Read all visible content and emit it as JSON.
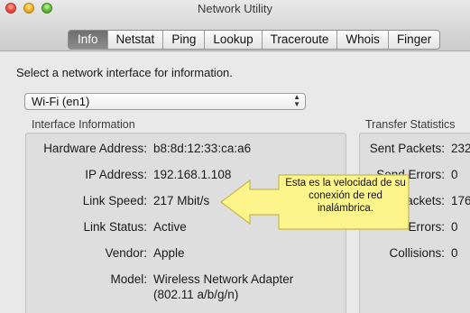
{
  "window": {
    "title": "Network Utility"
  },
  "tabs": [
    {
      "label": "Info",
      "active": true
    },
    {
      "label": "Netstat"
    },
    {
      "label": "Ping"
    },
    {
      "label": "Lookup"
    },
    {
      "label": "Traceroute"
    },
    {
      "label": "Whois"
    },
    {
      "label": "Finger"
    }
  ],
  "prompt": "Select a network interface for information.",
  "interface_select": {
    "value": "Wi-Fi (en1)"
  },
  "interface_info": {
    "label": "Interface Information",
    "rows": [
      {
        "label": "Hardware Address:",
        "value": "b8:8d:12:33:ca:a6"
      },
      {
        "label": "IP Address:",
        "value": "192.168.1.108"
      },
      {
        "label": "Link Speed:",
        "value": "217 Mbit/s"
      },
      {
        "label": "Link Status:",
        "value": "Active"
      },
      {
        "label": "Vendor:",
        "value": "Apple"
      },
      {
        "label": "Model:",
        "value": "Wireless Network Adapter",
        "value2": "(802.11 a/b/g/n)"
      }
    ]
  },
  "transfer_stats": {
    "label": "Transfer Statistics",
    "rows": [
      {
        "label": "Sent Packets:",
        "value": "232"
      },
      {
        "label": "Send Errors:",
        "value": "0"
      },
      {
        "label": "Packets:",
        "value": "176"
      },
      {
        "label": "Errors:",
        "value": "0"
      },
      {
        "label": "Collisions:",
        "value": "0"
      }
    ]
  },
  "callout": {
    "text": "Esta es la velocidad de su conexión de red inalámbrica.",
    "fill_color": "#fdf58c",
    "stroke_color": "#c9b94a"
  },
  "colors": {
    "active_tab": "#7a7a7a"
  }
}
